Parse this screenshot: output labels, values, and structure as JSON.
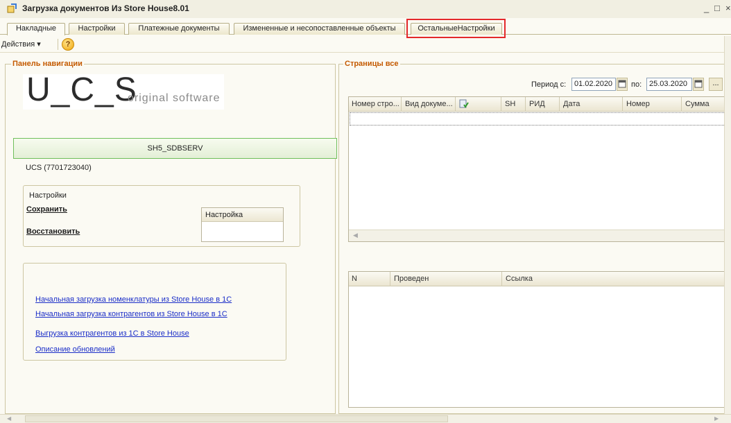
{
  "window": {
    "title": "Загрузка документов Из Store House8.01",
    "controls": [
      "_",
      "□",
      "×"
    ]
  },
  "tabs": [
    {
      "label": "Накладные",
      "active": true
    },
    {
      "label": "Настройки",
      "active": false
    },
    {
      "label": "Платежные документы",
      "active": false
    },
    {
      "label": "Измененные и несопоставленные объекты",
      "active": false
    },
    {
      "label": "ОстальныеНастройки",
      "active": false,
      "highlighted": true
    }
  ],
  "toolbar": {
    "actions_label": "Действия ▾",
    "help_glyph": "?"
  },
  "nav_panel": {
    "title": "Панель навигации",
    "logo": {
      "main": "U_C_S",
      "sub": "original software"
    },
    "server_button": "SH5_SDBSERV",
    "company": "UCS (7701723040)",
    "settings": {
      "title": "Настройки",
      "save_link": "Сохранить",
      "restore_link": "Восстановить",
      "column_header": "Настройка"
    },
    "links": [
      "Начальная загрузка номенклатуры из Store House в 1С",
      "Начальная загрузка контрагентов из Store House в 1С",
      "Выгрузка контрагентов из 1С в Store House ",
      "Описание обновлений"
    ]
  },
  "pages_panel": {
    "title": "Страницы все",
    "period_from_label": "Период с:",
    "period_from": "01.02.2020",
    "period_to_label": "по:",
    "period_to": "25.03.2020",
    "more_btn": "...",
    "table_columns": [
      "Номер стро...",
      "Вид докуме...",
      "",
      "SH",
      "РИД",
      "Дата",
      "Номер",
      "Сумма"
    ],
    "lower_columns": [
      "N",
      "Проведен",
      "Ссылка"
    ]
  },
  "colors": {
    "accent_orange": "#c45a00",
    "highlight_red": "#e3282a",
    "link_blue": "#1a2dc8",
    "server_border": "#6fbf5b"
  }
}
